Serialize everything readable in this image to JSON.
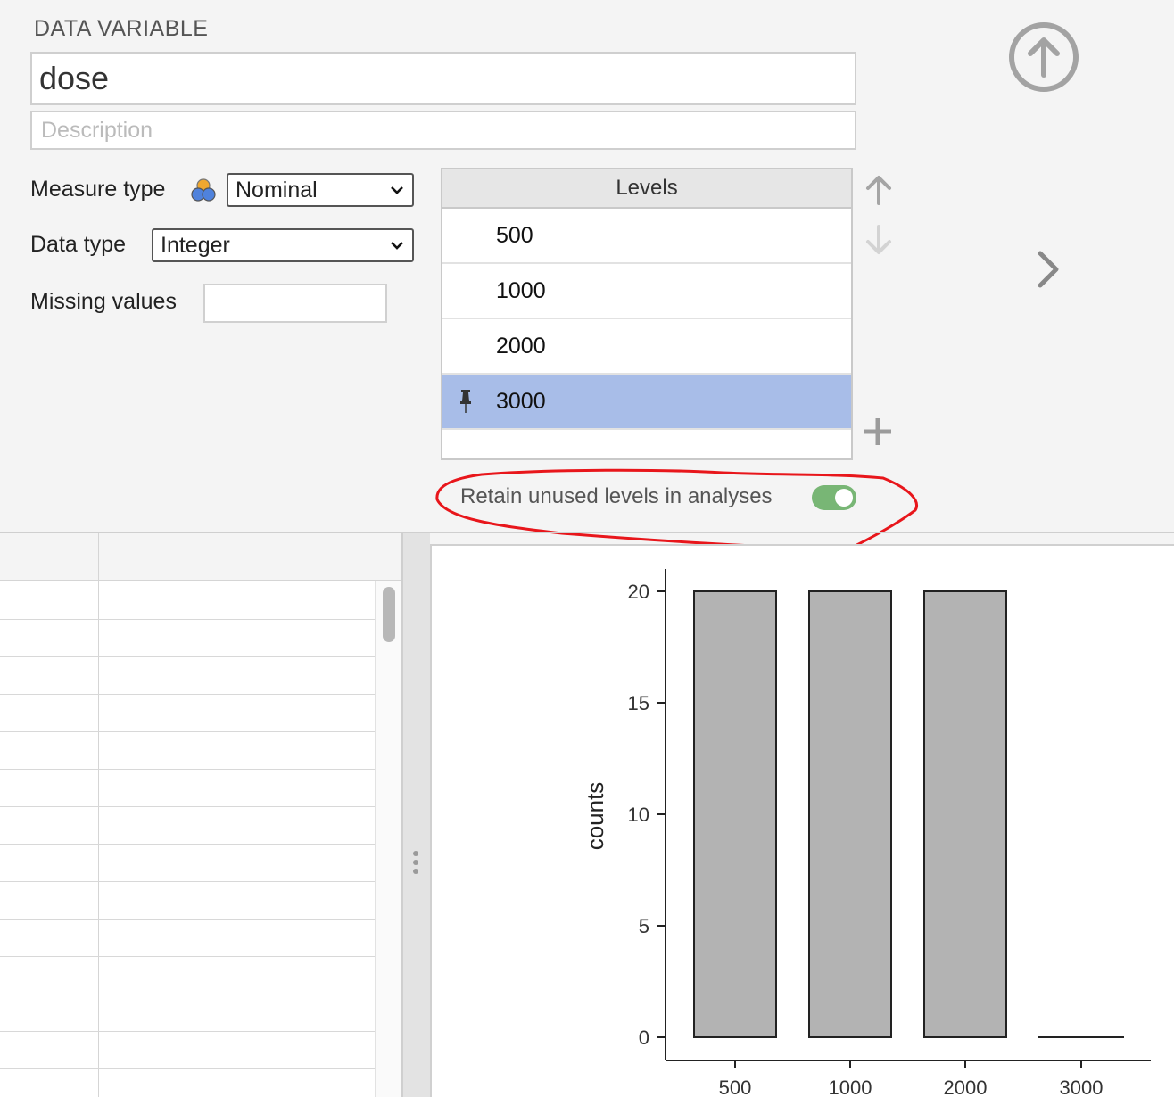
{
  "header": {
    "section_label": "DATA VARIABLE"
  },
  "variable": {
    "name": "dose",
    "description_placeholder": "Description"
  },
  "measure_type": {
    "label": "Measure type",
    "value": "Nominal"
  },
  "data_type": {
    "label": "Data type",
    "value": "Integer"
  },
  "missing_values": {
    "label": "Missing values",
    "value": ""
  },
  "levels": {
    "header": "Levels",
    "items": [
      {
        "label": "500",
        "selected": false
      },
      {
        "label": "1000",
        "selected": false
      },
      {
        "label": "2000",
        "selected": false
      },
      {
        "label": "3000",
        "selected": true
      }
    ]
  },
  "retain": {
    "label": "Retain unused levels in analyses",
    "on": true
  },
  "colors": {
    "selected_row": "#a8bde8",
    "toggle_on": "#78b675",
    "annotation": "#e8161b",
    "bar_fill": "#b3b3b3"
  },
  "icons": [
    "upload-circle-icon",
    "measure-type-nominal-icon",
    "chevron-down-icon",
    "move-up-arrow-icon",
    "move-down-arrow-icon",
    "next-chevron-icon",
    "add-level-plus-icon",
    "pin-icon"
  ],
  "chart_data": {
    "type": "bar",
    "categories": [
      "500",
      "1000",
      "2000",
      "3000"
    ],
    "values": [
      20,
      20,
      20,
      0
    ],
    "title": "",
    "xlabel": "",
    "ylabel": "counts",
    "ylim": [
      0,
      20
    ],
    "yticks": [
      0,
      5,
      10,
      15,
      20
    ],
    "grid": false
  }
}
